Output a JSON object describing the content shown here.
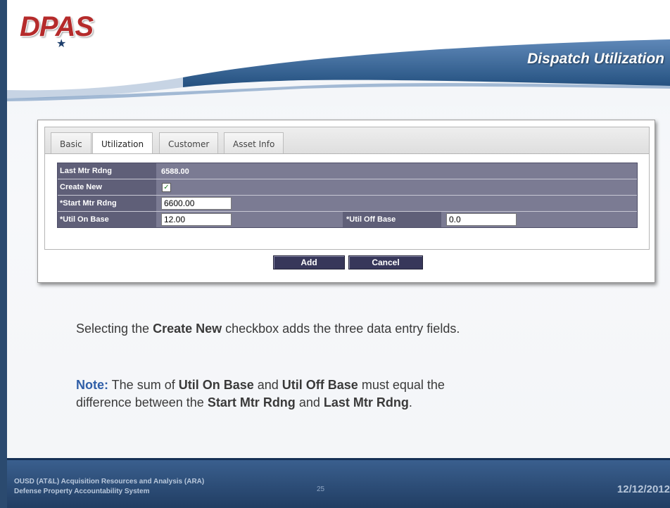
{
  "header": {
    "logo_text": "DPAS",
    "title": "Dispatch Utilization"
  },
  "tabs": [
    {
      "label": "Basic",
      "active": false
    },
    {
      "label": "Utilization",
      "active": true
    },
    {
      "label": "Customer",
      "active": false
    },
    {
      "label": "Asset Info",
      "active": false
    }
  ],
  "form": {
    "last_mtr_label": "Last Mtr Rdng",
    "last_mtr_value": "6588.00",
    "create_new_label": "Create New",
    "create_new_checked": true,
    "create_new_mark": "✓",
    "start_mtr_label": "*Start Mtr Rdng",
    "start_mtr_value": "6600.00",
    "util_on_label": "*Util On Base",
    "util_on_value": "12.00",
    "util_off_label": "*Util Off Base",
    "util_off_value": "0.0"
  },
  "buttons": {
    "add": "Add",
    "cancel": "Cancel"
  },
  "text": {
    "p1_a": "Selecting the ",
    "p1_b": "Create New",
    "p1_c": " checkbox adds the three data entry fields.",
    "note_key": "Note:",
    "p2_a": " The sum of ",
    "p2_b": "Util On Base",
    "p2_c": " and ",
    "p2_d": "Util Off Base",
    "p2_e": " must equal the",
    "p3_a": "difference between the ",
    "p3_b": "Start Mtr Rdng",
    "p3_c": " and ",
    "p3_d": "Last Mtr Rdng",
    "p3_e": "."
  },
  "footer": {
    "line1": "OUSD (AT&L) Acquisition Resources and Analysis (ARA)",
    "line2": "Defense Property Accountability System",
    "page": "25",
    "date": "12/12/2012"
  },
  "colors": {
    "grid_bg": "#7b7b93",
    "button_bg": "#37375a",
    "note_blue": "#2f5ea8",
    "footer_blue": "#2b4a6f"
  }
}
